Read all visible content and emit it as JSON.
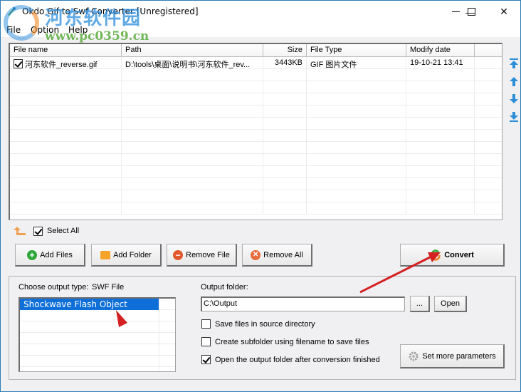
{
  "window": {
    "title": "Okdo Gif to Swf Converter [Unregistered]",
    "controls": {
      "minimize": "—",
      "maximize": "☐",
      "close": "✕"
    }
  },
  "watermark": {
    "line1": "河东软件园",
    "line2": "www.pc0359.cn"
  },
  "menu": [
    "File",
    "Option",
    "Help"
  ],
  "file_table": {
    "columns": [
      "File name",
      "Path",
      "Size",
      "File Type",
      "Modify date",
      ""
    ],
    "rows": [
      {
        "checked": true,
        "name": "河东软件_reverse.gif",
        "path": "D:\\tools\\桌面\\说明书\\河东软件_rev...",
        "size": "3443KB",
        "type": "GIF 图片文件",
        "date": "19-10-21 13:41"
      }
    ],
    "empty_rows": 12
  },
  "side_arrows": [
    "move-top-icon",
    "move-up-icon",
    "move-down-icon",
    "move-bottom-icon"
  ],
  "select_all": {
    "label": "Select All",
    "checked": true
  },
  "buttons": {
    "add_files": "Add Files",
    "add_folder": "Add Folder",
    "remove_file": "Remove File",
    "remove_all": "Remove All",
    "convert": "Convert",
    "browse": "...",
    "open": "Open",
    "set_params": "Set more parameters"
  },
  "output": {
    "type_label": "Choose output type:",
    "type_value": "SWF File",
    "types": [
      "Shockwave Flash Object (*.swf)"
    ],
    "folder_label": "Output folder:",
    "folder_value": "C:\\Output",
    "options": [
      {
        "label": "Save files in source directory",
        "checked": false
      },
      {
        "label": "Create subfolder using filename to save files",
        "checked": false
      },
      {
        "label": "Open the output folder after conversion finished",
        "checked": true
      }
    ]
  },
  "colors": {
    "accent": "#0f6fd8",
    "window_border": "#2d7db3",
    "annotation": "#d42020"
  }
}
